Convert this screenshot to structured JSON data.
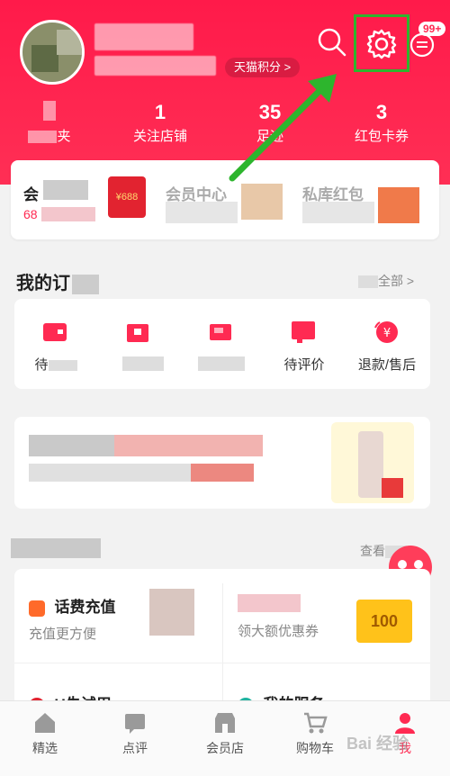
{
  "header": {
    "points_tag": "天猫积分 >",
    "message_badge": "99+"
  },
  "stats": [
    {
      "num": "",
      "label": "夹"
    },
    {
      "num": "1",
      "label": "关注店铺"
    },
    {
      "num": "35",
      "label": "足迹"
    },
    {
      "num": "3",
      "label": "红包卡券"
    }
  ],
  "member_card": {
    "item1_title": "会",
    "item1_sub": "68",
    "redpacket_text": "¥688",
    "item2_title": "会员中心",
    "item3_title": "私库红包"
  },
  "orders": {
    "title": "我的订",
    "see_all": "全部 >",
    "items": [
      {
        "label": "待"
      },
      {
        "label": ""
      },
      {
        "label": ""
      },
      {
        "label": "待评价"
      },
      {
        "label": "退款/售后"
      }
    ]
  },
  "services": {
    "see_all": "查看",
    "items": [
      {
        "title": "话费充值",
        "sub": "充值更方便"
      },
      {
        "title": "",
        "sub": "领大额优惠券"
      },
      {
        "title": "U先试用",
        "sub": ""
      },
      {
        "title": "我的服务",
        "sub": ""
      }
    ],
    "coupon_value": "100"
  },
  "tabbar": [
    {
      "label": "精选",
      "icon": "home-icon"
    },
    {
      "label": "点评",
      "icon": "review-icon"
    },
    {
      "label": "会员店",
      "icon": "store-icon"
    },
    {
      "label": "购物车",
      "icon": "cart-icon"
    },
    {
      "label": "我",
      "icon": "profile-icon"
    }
  ],
  "watermark": "Bai 经验",
  "colors": {
    "brand_red": "#ff2a52",
    "highlight_green": "#2db52d"
  }
}
